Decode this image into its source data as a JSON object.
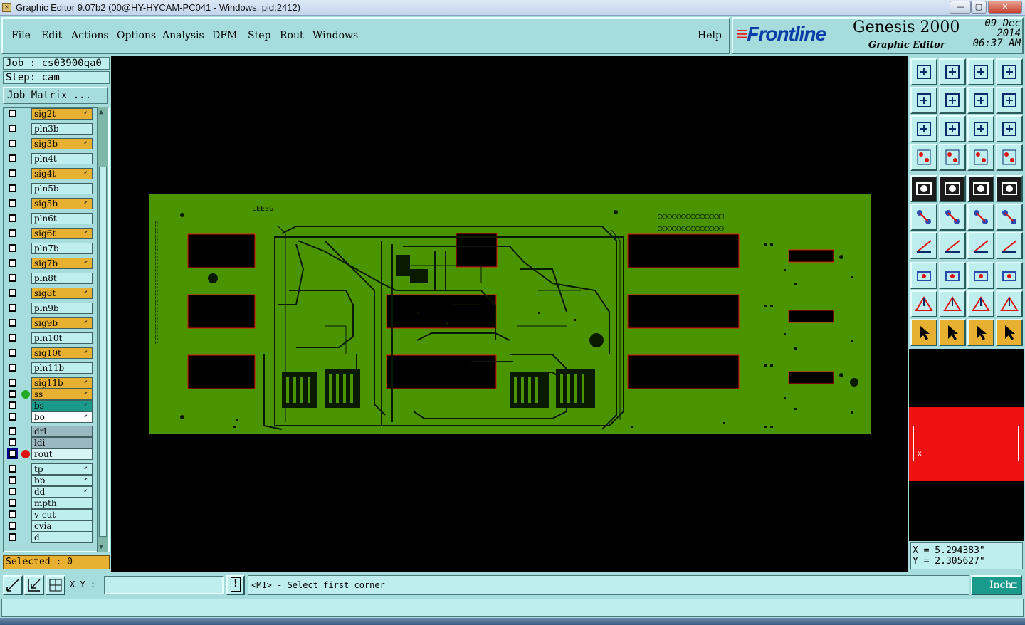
{
  "window": {
    "title": "Graphic Editor 9.07b2 (00@HY-HYCAM-PC041 - Windows, pid:2412)",
    "controls": [
      "—",
      "▢",
      "✕"
    ]
  },
  "menu": {
    "items": [
      "File",
      "Edit",
      "Actions",
      "Options",
      "Analysis",
      "DFM",
      "Step",
      "Rout",
      "Windows"
    ],
    "help": "Help"
  },
  "brand": {
    "logo": "Frontline",
    "product": "Genesis 2000",
    "subtitle": "Graphic Editor",
    "date": "09 Dec 2014",
    "time": "06:37 AM"
  },
  "job": {
    "job_label": "Job : cs03900qa0",
    "step_label": "Step: cam",
    "matrix_button": "Job Matrix ..."
  },
  "layers": [
    {
      "name": "sig2t",
      "color": "#e8b030",
      "edit": true
    },
    {
      "name": "pln3b",
      "color": "#bfeeee",
      "edit": false
    },
    {
      "name": "sig3b",
      "color": "#e8b030",
      "edit": true
    },
    {
      "name": "pln4t",
      "color": "#bfeeee",
      "edit": false
    },
    {
      "name": "sig4t",
      "color": "#e8b030",
      "edit": true
    },
    {
      "name": "pln5b",
      "color": "#bfeeee",
      "edit": false
    },
    {
      "name": "sig5b",
      "color": "#e8b030",
      "edit": true
    },
    {
      "name": "pln6t",
      "color": "#bfeeee",
      "edit": false
    },
    {
      "name": "sig6t",
      "color": "#e8b030",
      "edit": true
    },
    {
      "name": "pln7b",
      "color": "#bfeeee",
      "edit": false
    },
    {
      "name": "sig7b",
      "color": "#e8b030",
      "edit": true
    },
    {
      "name": "pln8t",
      "color": "#bfeeee",
      "edit": false
    },
    {
      "name": "sig8t",
      "color": "#e8b030",
      "edit": true
    },
    {
      "name": "pln9b",
      "color": "#bfeeee",
      "edit": false
    },
    {
      "name": "sig9b",
      "color": "#e8b030",
      "edit": true
    },
    {
      "name": "pln10t",
      "color": "#bfeeee",
      "edit": false
    },
    {
      "name": "sig10t",
      "color": "#e8b030",
      "edit": true
    },
    {
      "name": "pln11b",
      "color": "#bfeeee",
      "edit": false
    },
    {
      "name": "sig11b",
      "color": "#e8b030",
      "edit": true
    },
    {
      "name": "ss",
      "color": "#e8b030",
      "edit": true,
      "dot": "#22aa22"
    },
    {
      "name": "bs",
      "color": "#1a9a8a",
      "edit": true
    },
    {
      "name": "bo",
      "color": "#ffffff",
      "edit": true
    },
    {
      "name": "drl",
      "color": "#9ab8c0",
      "edit": false
    },
    {
      "name": "ldi",
      "color": "#9ab8c0",
      "edit": false
    },
    {
      "name": "rout",
      "color": "#d8f4f4",
      "edit": false,
      "dot": "#e01010",
      "checked": true
    },
    {
      "name": "tp",
      "color": "#bfeeee",
      "edit": true
    },
    {
      "name": "bp",
      "color": "#bfeeee",
      "edit": true
    },
    {
      "name": "dd",
      "color": "#bfeeee",
      "edit": true
    },
    {
      "name": "mpth",
      "color": "#bfeeee",
      "edit": false
    },
    {
      "name": "v-cut",
      "color": "#bfeeee",
      "edit": false
    },
    {
      "name": "cvia",
      "color": "#bfeeee",
      "edit": false
    },
    {
      "name": "d",
      "color": "#bfeeee",
      "edit": false
    }
  ],
  "selected_label": "Selected : 0",
  "coordinates": {
    "x_label": "X = 5.294383\"",
    "y_label": "Y = 2.305627\""
  },
  "bottom": {
    "xy_label": "X Y :",
    "xy_value": "",
    "prompt": "<M1> - Select first corner",
    "unit": "Inch"
  },
  "board_labels": {
    "top_text": "LEEEG",
    "right_pads_top": "○○○○○○○○○○○○○□",
    "right_pads_bottom": "○○○○○○○○○○○○○○",
    "side_text": "ΞΞΞΞΞΞΞΞΞΞΞΞΞΞΞΞΞΞΞΞΞΞΞΞΞΞΞΞΞΞΞΞΞΞΞΞ"
  },
  "icons": {
    "toolbar_rows": [
      [
        "zoom-in-layer-icon",
        "zoom-out-layer-icon",
        "home-icon",
        "panel-icon"
      ],
      [
        "pan-left-icon",
        "pan-right-icon",
        "redraw-icon",
        "snap-icon"
      ],
      [
        "fit-zoom-icon",
        "center-zoom-icon",
        "one-to-two-icon",
        "help-icon"
      ],
      [
        "settings-icon",
        "grid-icon",
        "layer-compare-icon",
        "layer-compare-2-icon"
      ],
      [
        "record-icon",
        "erase-icon",
        "ruler-icon",
        "stop-icon"
      ],
      [
        "route-icon",
        "cross-icon",
        "add-line-icon",
        "add-arc-icon"
      ],
      [
        "angle-icon",
        "line-edit-icon",
        "rotate-icon",
        "mirror-icon"
      ],
      [
        "pad-icon",
        "divide-icon",
        "measure-icon",
        "group-icon"
      ],
      [
        "triangle-1-icon",
        "triangle-2-icon",
        "triangle-3-icon",
        "triangle-4-icon"
      ],
      [
        "select-icon",
        "select-box-icon",
        "select-circle-icon",
        "select-poly-icon"
      ]
    ]
  },
  "colors": {
    "panel": "#a6dcdc",
    "board": "#4a9400",
    "highlight": "#e8b030",
    "overview_red": "#ee1111"
  }
}
